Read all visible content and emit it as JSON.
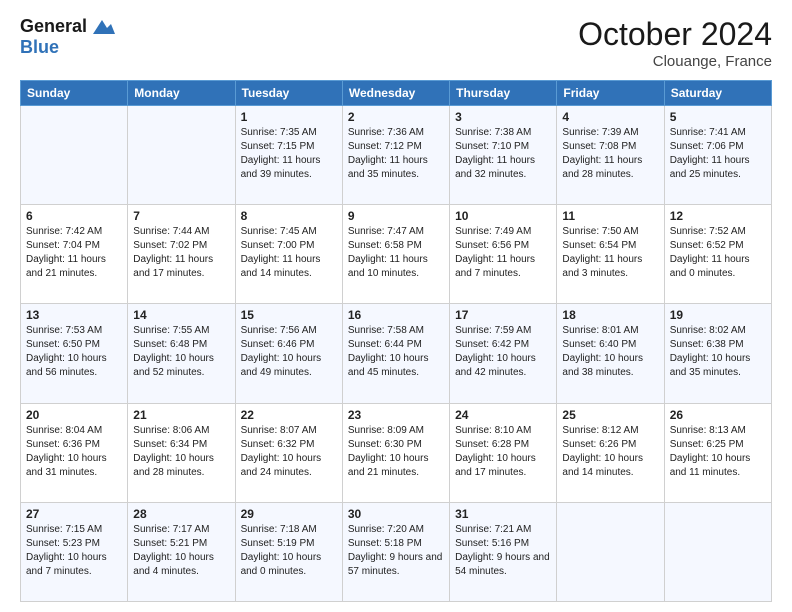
{
  "header": {
    "logo_line1": "General",
    "logo_line2": "Blue",
    "month": "October 2024",
    "location": "Clouange, France"
  },
  "days_of_week": [
    "Sunday",
    "Monday",
    "Tuesday",
    "Wednesday",
    "Thursday",
    "Friday",
    "Saturday"
  ],
  "weeks": [
    [
      {
        "day": "",
        "text": ""
      },
      {
        "day": "",
        "text": ""
      },
      {
        "day": "1",
        "text": "Sunrise: 7:35 AM\nSunset: 7:15 PM\nDaylight: 11 hours and 39 minutes."
      },
      {
        "day": "2",
        "text": "Sunrise: 7:36 AM\nSunset: 7:12 PM\nDaylight: 11 hours and 35 minutes."
      },
      {
        "day": "3",
        "text": "Sunrise: 7:38 AM\nSunset: 7:10 PM\nDaylight: 11 hours and 32 minutes."
      },
      {
        "day": "4",
        "text": "Sunrise: 7:39 AM\nSunset: 7:08 PM\nDaylight: 11 hours and 28 minutes."
      },
      {
        "day": "5",
        "text": "Sunrise: 7:41 AM\nSunset: 7:06 PM\nDaylight: 11 hours and 25 minutes."
      }
    ],
    [
      {
        "day": "6",
        "text": "Sunrise: 7:42 AM\nSunset: 7:04 PM\nDaylight: 11 hours and 21 minutes."
      },
      {
        "day": "7",
        "text": "Sunrise: 7:44 AM\nSunset: 7:02 PM\nDaylight: 11 hours and 17 minutes."
      },
      {
        "day": "8",
        "text": "Sunrise: 7:45 AM\nSunset: 7:00 PM\nDaylight: 11 hours and 14 minutes."
      },
      {
        "day": "9",
        "text": "Sunrise: 7:47 AM\nSunset: 6:58 PM\nDaylight: 11 hours and 10 minutes."
      },
      {
        "day": "10",
        "text": "Sunrise: 7:49 AM\nSunset: 6:56 PM\nDaylight: 11 hours and 7 minutes."
      },
      {
        "day": "11",
        "text": "Sunrise: 7:50 AM\nSunset: 6:54 PM\nDaylight: 11 hours and 3 minutes."
      },
      {
        "day": "12",
        "text": "Sunrise: 7:52 AM\nSunset: 6:52 PM\nDaylight: 11 hours and 0 minutes."
      }
    ],
    [
      {
        "day": "13",
        "text": "Sunrise: 7:53 AM\nSunset: 6:50 PM\nDaylight: 10 hours and 56 minutes."
      },
      {
        "day": "14",
        "text": "Sunrise: 7:55 AM\nSunset: 6:48 PM\nDaylight: 10 hours and 52 minutes."
      },
      {
        "day": "15",
        "text": "Sunrise: 7:56 AM\nSunset: 6:46 PM\nDaylight: 10 hours and 49 minutes."
      },
      {
        "day": "16",
        "text": "Sunrise: 7:58 AM\nSunset: 6:44 PM\nDaylight: 10 hours and 45 minutes."
      },
      {
        "day": "17",
        "text": "Sunrise: 7:59 AM\nSunset: 6:42 PM\nDaylight: 10 hours and 42 minutes."
      },
      {
        "day": "18",
        "text": "Sunrise: 8:01 AM\nSunset: 6:40 PM\nDaylight: 10 hours and 38 minutes."
      },
      {
        "day": "19",
        "text": "Sunrise: 8:02 AM\nSunset: 6:38 PM\nDaylight: 10 hours and 35 minutes."
      }
    ],
    [
      {
        "day": "20",
        "text": "Sunrise: 8:04 AM\nSunset: 6:36 PM\nDaylight: 10 hours and 31 minutes."
      },
      {
        "day": "21",
        "text": "Sunrise: 8:06 AM\nSunset: 6:34 PM\nDaylight: 10 hours and 28 minutes."
      },
      {
        "day": "22",
        "text": "Sunrise: 8:07 AM\nSunset: 6:32 PM\nDaylight: 10 hours and 24 minutes."
      },
      {
        "day": "23",
        "text": "Sunrise: 8:09 AM\nSunset: 6:30 PM\nDaylight: 10 hours and 21 minutes."
      },
      {
        "day": "24",
        "text": "Sunrise: 8:10 AM\nSunset: 6:28 PM\nDaylight: 10 hours and 17 minutes."
      },
      {
        "day": "25",
        "text": "Sunrise: 8:12 AM\nSunset: 6:26 PM\nDaylight: 10 hours and 14 minutes."
      },
      {
        "day": "26",
        "text": "Sunrise: 8:13 AM\nSunset: 6:25 PM\nDaylight: 10 hours and 11 minutes."
      }
    ],
    [
      {
        "day": "27",
        "text": "Sunrise: 7:15 AM\nSunset: 5:23 PM\nDaylight: 10 hours and 7 minutes."
      },
      {
        "day": "28",
        "text": "Sunrise: 7:17 AM\nSunset: 5:21 PM\nDaylight: 10 hours and 4 minutes."
      },
      {
        "day": "29",
        "text": "Sunrise: 7:18 AM\nSunset: 5:19 PM\nDaylight: 10 hours and 0 minutes."
      },
      {
        "day": "30",
        "text": "Sunrise: 7:20 AM\nSunset: 5:18 PM\nDaylight: 9 hours and 57 minutes."
      },
      {
        "day": "31",
        "text": "Sunrise: 7:21 AM\nSunset: 5:16 PM\nDaylight: 9 hours and 54 minutes."
      },
      {
        "day": "",
        "text": ""
      },
      {
        "day": "",
        "text": ""
      }
    ]
  ]
}
